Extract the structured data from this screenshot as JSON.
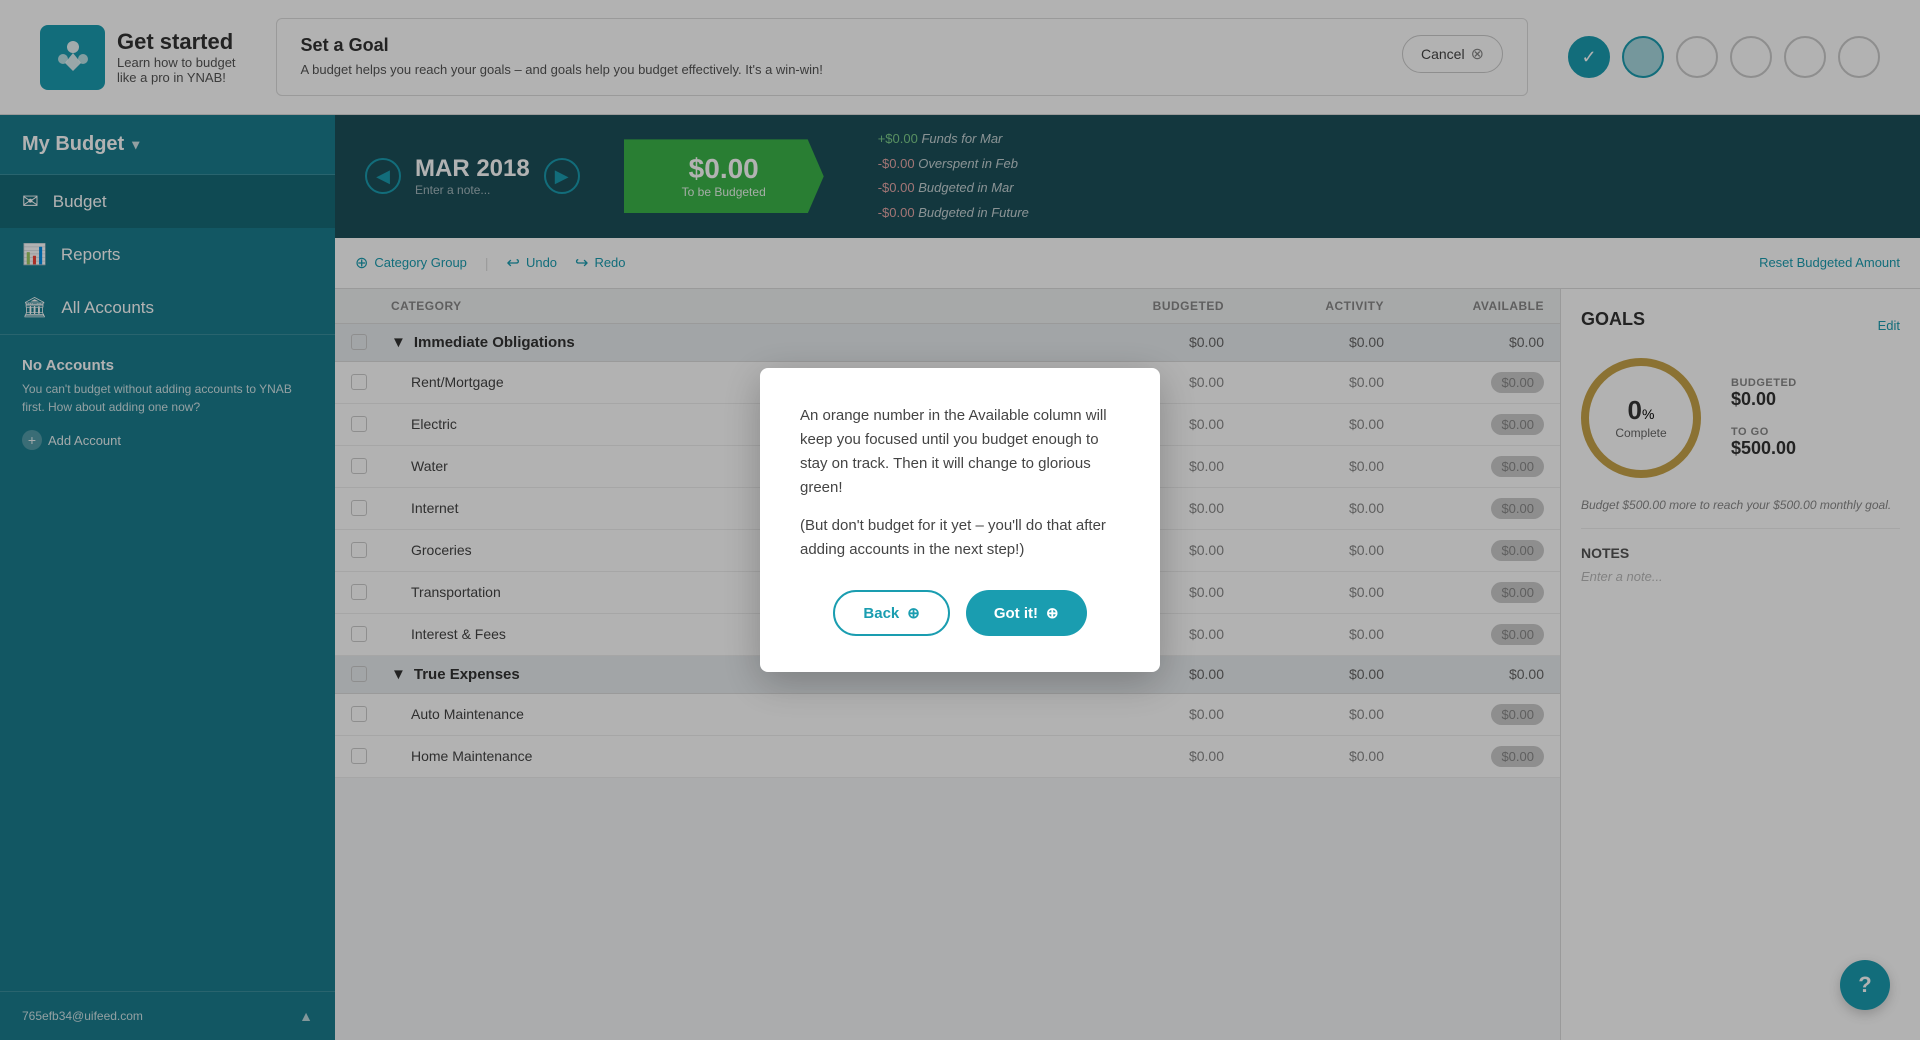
{
  "topBanner": {
    "logoIcon": "Y",
    "getStartedTitle": "Get started",
    "getStartedDesc1": "Learn how to budget",
    "getStartedDesc2": "like a pro in YNAB!",
    "goalTitle": "Set a Goal",
    "goalDesc": "A budget helps you reach your goals – and goals help you budget effectively. It's a win-win!",
    "cancelLabel": "Cancel",
    "progressDots": [
      {
        "state": "completed"
      },
      {
        "state": "active"
      },
      {
        "state": "inactive"
      },
      {
        "state": "inactive"
      },
      {
        "state": "inactive"
      },
      {
        "state": "inactive"
      }
    ]
  },
  "sidebar": {
    "myBudgetLabel": "My Budget",
    "navItems": [
      {
        "label": "Budget",
        "icon": "✉"
      },
      {
        "label": "Reports",
        "icon": "📊"
      },
      {
        "label": "All Accounts",
        "icon": "🏛"
      }
    ],
    "noAccountsTitle": "No Accounts",
    "noAccountsDesc": "You can't budget without adding accounts to YNAB first. How about adding one now?",
    "addAccountLabel": "Add Account",
    "userEmail": "765efb34@uifeed.com"
  },
  "budgetHeader": {
    "prevArrow": "◀",
    "nextArrow": "▶",
    "month": "MAR 2018",
    "noteLabel": "Enter a note...",
    "toBeBudgeted": "$0.00",
    "toBeBudgetedLabel": "To be Budgeted",
    "stats": [
      {
        "prefix": "+$0.00",
        "label": "Funds for Mar"
      },
      {
        "prefix": "-$0.00",
        "label": "Overspent in Feb"
      },
      {
        "prefix": "-$0.00",
        "label": "Budgeted in Mar"
      },
      {
        "prefix": "-$0.00",
        "label": "Budgeted in Future"
      }
    ]
  },
  "toolbar": {
    "categoryGroupLabel": "Category Group",
    "undoLabel": "Undo",
    "redoLabel": "Redo",
    "resetLabel": "Reset Budgeted Amount"
  },
  "table": {
    "columns": [
      "CATEGORY",
      "BUDGETED",
      "ACTIVITY",
      "AVAILABLE"
    ],
    "groups": [
      {
        "name": "Immediate Obligations",
        "budgeted": "$0.00",
        "activity": "$0.00",
        "available": "$0.00",
        "categories": [
          {
            "name": "Rent/Mortgage",
            "budgeted": "$0.00",
            "activity": "$0.00",
            "available": "$0.00"
          },
          {
            "name": "Electric",
            "budgeted": "$0.00",
            "activity": "$0.00",
            "available": "$0.00"
          },
          {
            "name": "Water",
            "budgeted": "$0.00",
            "activity": "$0.00",
            "available": "$0.00"
          },
          {
            "name": "Internet",
            "budgeted": "$0.00",
            "activity": "$0.00",
            "available": "$0.00"
          },
          {
            "name": "Groceries",
            "budgeted": "$0.00",
            "activity": "$0.00",
            "available": "$0.00"
          },
          {
            "name": "Transportation",
            "budgeted": "$0.00",
            "activity": "$0.00",
            "available": "$0.00"
          },
          {
            "name": "Interest & Fees",
            "budgeted": "$0.00",
            "activity": "$0.00",
            "available": "$0.00"
          }
        ]
      },
      {
        "name": "True Expenses",
        "budgeted": "$0.00",
        "activity": "$0.00",
        "available": "$0.00",
        "categories": [
          {
            "name": "Auto Maintenance",
            "budgeted": "$0.00",
            "activity": "$0.00",
            "available": "$0.00"
          },
          {
            "name": "Home Maintenance",
            "budgeted": "$0.00",
            "activity": "$0.00",
            "available": "$0.00"
          }
        ]
      }
    ]
  },
  "rightPanel": {
    "goalsTitle": "GOALS",
    "editLabel": "Edit",
    "percentage": "0",
    "percentSign": "%",
    "completeLabel": "Complete",
    "budgetedLabel": "BUDGETED",
    "budgetedValue": "$0.00",
    "toGoLabel": "TO GO",
    "toGoValue": "$500.00",
    "goalNote": "Budget $500.00 more to reach your $500.00 monthly goal.",
    "notesTitle": "NOTES",
    "notesPlaceholder": "Enter a note..."
  },
  "modal": {
    "text1": "An orange number in the Available column will keep you focused until you budget enough to stay on track. Then it will change to glorious green!",
    "text2": "(But don't budget for it yet – you'll do that after adding accounts in the next step!)",
    "backLabel": "Back",
    "gotItLabel": "Got it!"
  },
  "helpBtn": "?"
}
